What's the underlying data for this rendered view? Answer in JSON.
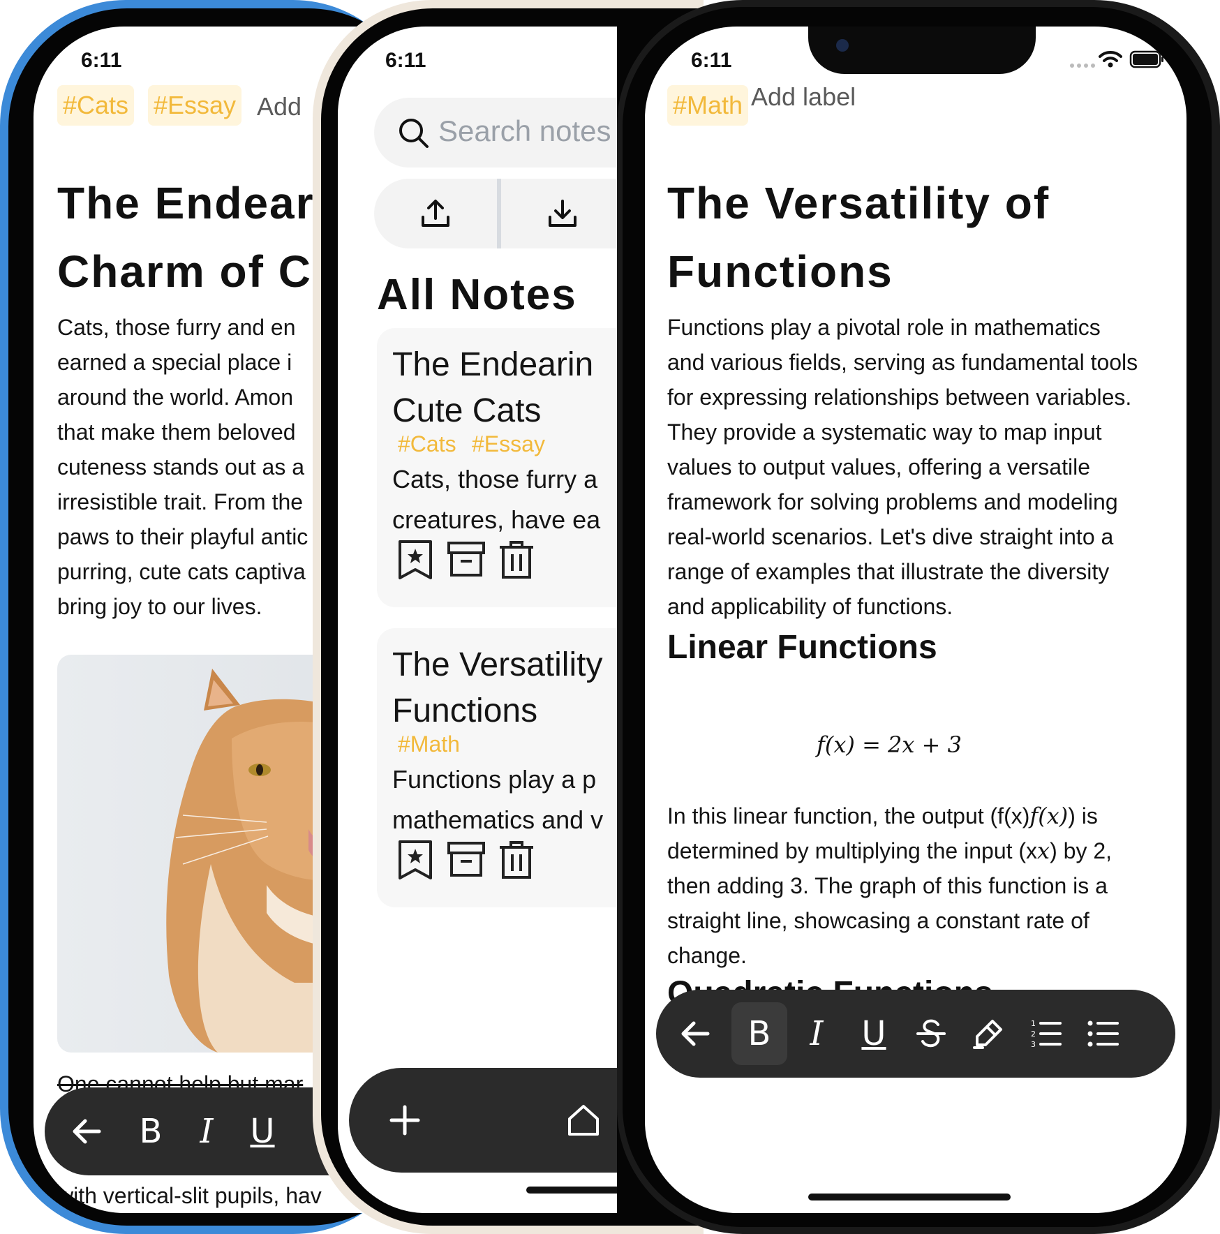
{
  "status": {
    "time": "6:11"
  },
  "phone1": {
    "tags": [
      "#Cats",
      "#Essay"
    ],
    "add_label": "Add",
    "title_line1": "The Endear",
    "title_line2": "Charm of C",
    "body_lines": [
      "Cats, those furry and en",
      "earned a special place i",
      "around the world. Amon",
      "that make them beloved",
      "cuteness stands out as a",
      "irresistible trait. From the",
      "paws to their playful antic",
      "purring, cute cats captiva",
      "bring joy to our lives."
    ],
    "hidden_line1": "One cannot help but mar",
    "hidden_line2": "with vertical-slit pupils, hav"
  },
  "phone2": {
    "search_placeholder": "Search notes",
    "heading": "All Notes",
    "notes": [
      {
        "title_line1": "The Endearin",
        "title_line2": "Cute Cats",
        "tags": [
          "#Cats",
          "#Essay"
        ],
        "preview_line1": "Cats, those furry a",
        "preview_line2": "creatures, have ea"
      },
      {
        "title_line1": "The Versatility",
        "title_line2": "Functions",
        "tags": [
          "#Math"
        ],
        "preview_line1": "Functions play a p",
        "preview_line2": "mathematics and v"
      }
    ]
  },
  "phone3": {
    "tags": [
      "#Math"
    ],
    "add_label": "Add label",
    "title_line1": "The Versatility of",
    "title_line2": "Functions",
    "intro_lines": [
      "Functions play a pivotal role in mathematics",
      "and various fields, serving as fundamental tools",
      "for expressing relationships between variables.",
      "They provide a systematic way to map input",
      "values to output values, offering a versatile",
      "framework for solving problems and modeling",
      "real-world scenarios. Let's dive straight into a",
      "range of examples that illustrate the diversity",
      "and applicability of functions."
    ],
    "section1": "Linear Functions",
    "equation": "f(x) = 2x + 3",
    "para2_lines": [
      "In this linear function, the output (f(x)",
      "determined by multiplying the input (x",
      "then adding 3. The graph of this function is a",
      "straight line, showcasing a constant rate of",
      "change."
    ],
    "para2_fx": "f(x)",
    "para2_after_fx": ") is",
    "para2_x": "x",
    "para2_after_x": ") by 2,",
    "section2": "Quadratic Functions"
  },
  "toolbar": {
    "bold": "B",
    "italic": "I",
    "underline": "U"
  },
  "colors": {
    "tag_bg": "#fff5dc",
    "tag_text": "#f2b93b",
    "toolbar_bg": "#2b2b2b",
    "card_bg": "#f7f7f7"
  }
}
